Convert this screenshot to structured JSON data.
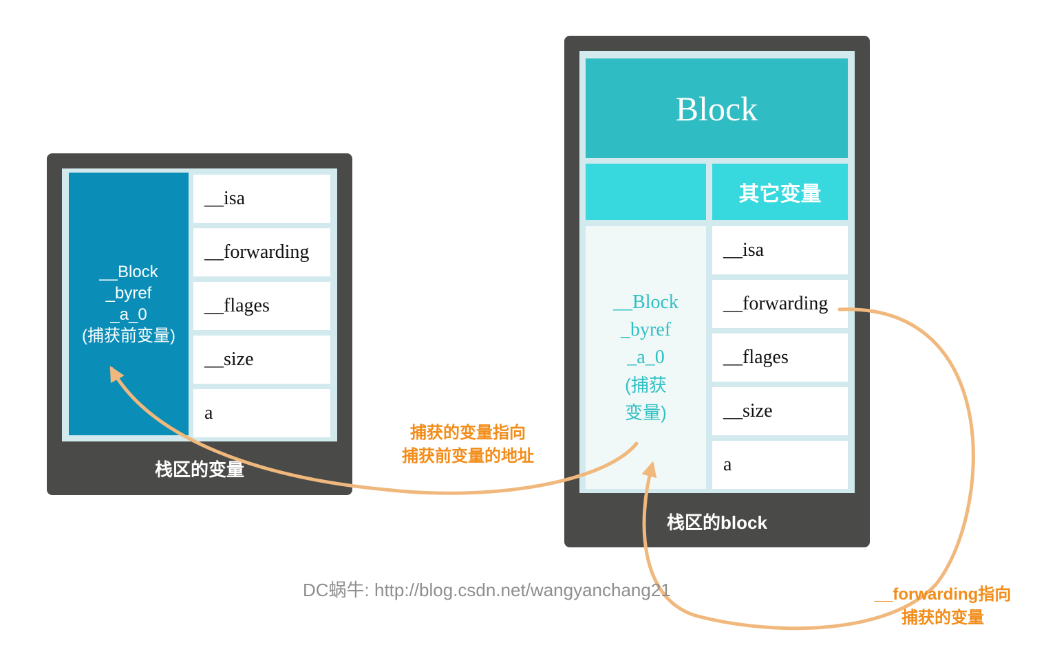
{
  "left_panel": {
    "byref_lines": [
      "__Block",
      "_byref",
      "_a_0",
      "(捕获前变量)"
    ],
    "fields": [
      "__isa",
      "__forwarding",
      "__flages",
      "__size",
      "a"
    ],
    "label": "栈区的变量"
  },
  "right_panel": {
    "header": "Block",
    "other_vars": "其它变量",
    "byref_lines": [
      "__Block",
      "_byref",
      "_a_0",
      "(捕获",
      "变量)"
    ],
    "fields": [
      "__isa",
      "__forwarding",
      "__flages",
      "__size",
      "a"
    ],
    "label": "栈区的block"
  },
  "annotations": {
    "captured_line1": "捕获的变量指向",
    "captured_line2": "捕获前变量的地址",
    "forwarding_line1": "__forwarding指向",
    "forwarding_line2": "捕获的变量"
  },
  "watermark": "DC蜗牛: http://blog.csdn.net/wangyanchang21",
  "colors": {
    "panel": "#4a4a48",
    "byref_left": "#0a8db6",
    "block_header": "#2fbcc3",
    "cyan_cells": "#37d8de",
    "arrow": "#f0b87c",
    "annotation_text": "#f28d1b"
  }
}
